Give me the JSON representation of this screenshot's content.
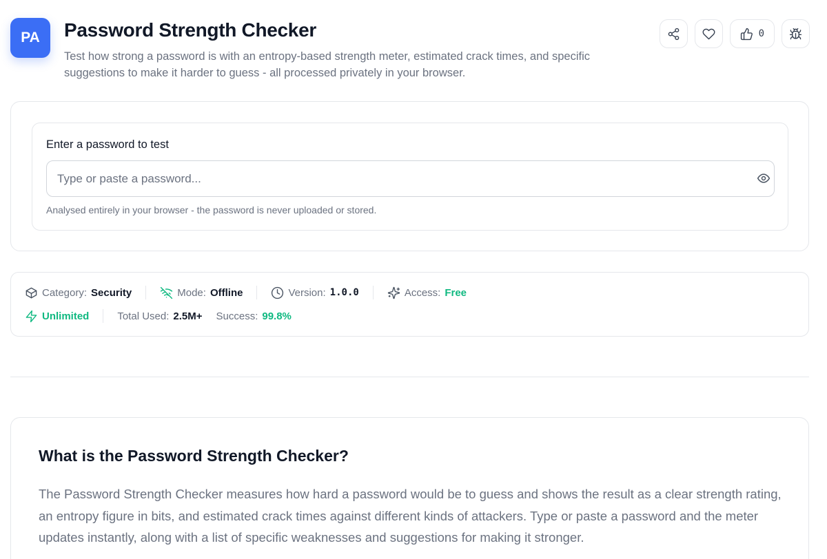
{
  "header": {
    "logo_text": "PA",
    "title": "Password Strength Checker",
    "subtitle": "Test how strong a password is with an entropy-based strength meter, estimated crack times, and specific suggestions to make it harder to guess - all processed privately in your browser.",
    "like_count": "0"
  },
  "input_card": {
    "label": "Enter a password to test",
    "placeholder": "Type or paste a password...",
    "value": "",
    "hint": "Analysed entirely in your browser - the password is never uploaded or stored."
  },
  "meta": {
    "category_label": "Category:",
    "category_value": "Security",
    "mode_label": "Mode:",
    "mode_value": "Offline",
    "version_label": "Version:",
    "version_value": "1.0.0",
    "access_label": "Access:",
    "access_value": "Free",
    "unlimited_label": "Unlimited",
    "total_label": "Total Used:",
    "total_value": "2.5M+",
    "success_label": "Success:",
    "success_value": "99.8%"
  },
  "about": {
    "title": "What is the Password Strength Checker?",
    "body": "The Password Strength Checker measures how hard a password would be to guess and shows the result as a clear strength rating, an entropy figure in bits, and estimated crack times against different kinds of attackers. Type or paste a password and the meter updates instantly, along with a list of specific weaknesses and suggestions for making it stronger."
  },
  "colors": {
    "accent": "#3b6ef5",
    "success_green": "#10b981",
    "text_muted": "#6b7280",
    "border": "#e5e7eb"
  },
  "icons": [
    "share-icon",
    "heart-icon",
    "thumbs-up-icon",
    "bug-icon",
    "eye-icon",
    "box-icon",
    "wifi-off-icon",
    "clock-icon",
    "sparkles-icon",
    "zap-icon"
  ]
}
